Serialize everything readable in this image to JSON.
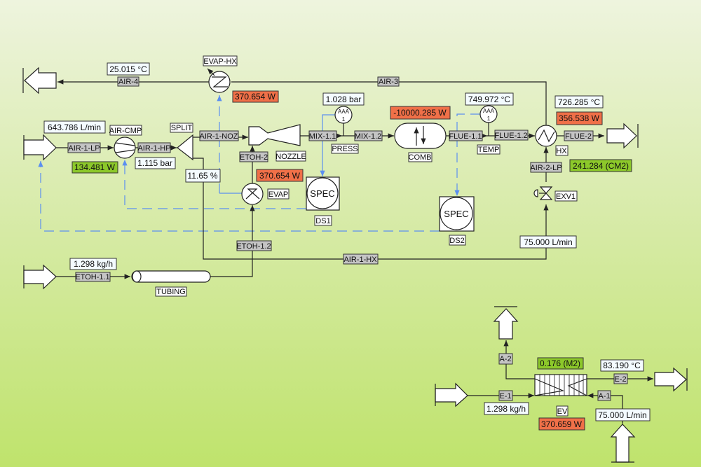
{
  "colors": {
    "background_top": "#eef4de",
    "background_bottom": "#bfe36c",
    "stream_label": "#c4c4c4",
    "heat_duty": "#f07048",
    "area": "#8cc82a",
    "signal": "#5b8ff0"
  },
  "streams": {
    "air4": "AIR-4",
    "air3": "AIR-3",
    "air1lp": "AIR-1-LP",
    "air1hp": "AIR-1-HP",
    "air1noz": "AIR-1-NOZ",
    "mix11": "MIX-1.1",
    "mix12": "MIX-1.2",
    "flue11": "FLUE-1.1",
    "flue12": "FLUE-1.2",
    "flue2": "FLUE-2",
    "air2lp": "AIR-2-LP",
    "air1hx": "AIR-1-HX",
    "etoh2": "ETOH-2",
    "etoh12": "ETOH-1.2",
    "etoh11": "ETOH-1.1",
    "e1": "E-1",
    "e2": "E-2",
    "a1": "A-1",
    "a2": "A-2"
  },
  "blocks": {
    "evaphx": "EVAP-HX",
    "aircmp": "AIR-CMP",
    "split": "SPLIT",
    "nozzle": "NOZZLE",
    "evap": "EVAP",
    "ds1": "DS1",
    "press": "PRESS",
    "comb": "COMB",
    "temp": "TEMP",
    "ds2": "DS2",
    "hx": "HX",
    "exv1": "EXV1",
    "tubing": "TUBING",
    "ev": "EV"
  },
  "values": {
    "air4_temp": "25.015 °C",
    "evaphx_duty": "370.654 W",
    "air_inlet_flow": "643.786 L/min",
    "cmp_power": "134.481 W",
    "cmp_pressure": "1.115 bar",
    "split_fraction": "11.65 %",
    "evap_duty": "370.654 W",
    "press_reading": "1.028 bar",
    "comb_duty": "-10000.285 W",
    "temp_reading": "749.972 °C",
    "hx_temp": "726.285 °C",
    "hx_duty": "356.538 W",
    "hx_area": "241.284 (CM2)",
    "air2_flow": "75.000 L/min",
    "etoh_flow": "1.298 kg/h",
    "ev_area": "0.176 (M2)",
    "ev_temp": "83.190 °C",
    "ev_etoh_flow": "1.298 kg/h",
    "ev_air_flow": "75.000 L/min",
    "ev_duty": "370.659 W"
  },
  "meter": {
    "line1": "AAA",
    "line2": "1"
  },
  "spec": {
    "label": "SPEC"
  }
}
